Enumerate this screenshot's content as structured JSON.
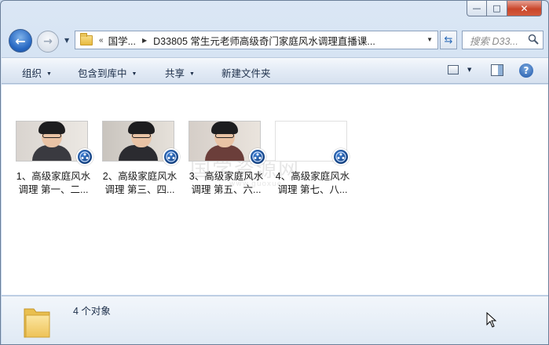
{
  "window": {
    "caption": {
      "minimize": "—",
      "maximize": "□",
      "close": "✕"
    }
  },
  "nav": {
    "back_glyph": "←",
    "forward_glyph": "→",
    "address": {
      "overflow": "«",
      "crumbs": [
        "国学...",
        "D33805 常生元老师高级奇门家庭风水调理直播课..."
      ]
    },
    "search": {
      "placeholder": "搜索 D33..."
    }
  },
  "toolbar": {
    "organize": "组织",
    "include_in_library": "包含到库中",
    "share": "共享",
    "new_folder": "新建文件夹",
    "help": "?"
  },
  "files": [
    {
      "label_line1": "1、高级家庭风水",
      "label_line2": "调理 第一、二...",
      "has_thumbnail": true
    },
    {
      "label_line1": "2、高级家庭风水",
      "label_line2": "调理 第三、四...",
      "has_thumbnail": true
    },
    {
      "label_line1": "3、高级家庭风水",
      "label_line2": "调理 第五、六...",
      "has_thumbnail": true
    },
    {
      "label_line1": "4、高级家庭风水",
      "label_line2": "调理 第七、八...",
      "has_thumbnail": false
    }
  ],
  "watermark": {
    "text": "国学资源网",
    "sub": "www.guoxue..."
  },
  "status": {
    "count_text": "4 个对象"
  },
  "colors": {
    "accent": "#2667c2",
    "toolbar_text": "#1d2f4a",
    "badge": "#13407f"
  }
}
